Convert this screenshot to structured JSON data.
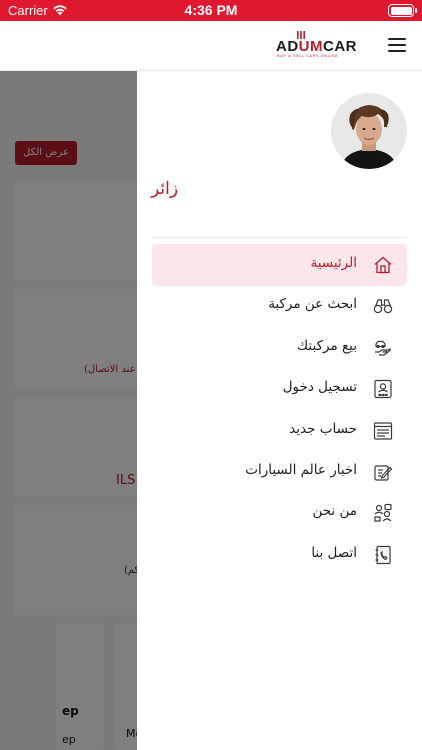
{
  "status_bar": {
    "carrier": "Carrier",
    "time": "4:36 PM"
  },
  "header": {
    "logo_text_a": "AD",
    "logo_text_b": "UM",
    "logo_text_c": "CAR",
    "logo_tagline": "BUY & SELL CARS ONLINE",
    "menu_icon": "hamburger-icon"
  },
  "background_page": {
    "show_all_button": "عرض الكل",
    "snippet_contact": "عند الاتصال)",
    "snippet_currency": "ILS",
    "snippet_km": "كم)",
    "snippet_brand_a": "ep",
    "snippet_brand_b": "ep",
    "snippet_model": "Mc"
  },
  "drawer": {
    "user_name": "زائر",
    "menu_items": [
      {
        "label": "الرئيسية",
        "icon": "home-icon",
        "active": true
      },
      {
        "label": "ابحث عن مركبة",
        "icon": "binoculars-icon",
        "active": false
      },
      {
        "label": "بيع مركبتك",
        "icon": "hand-car-icon",
        "active": false
      },
      {
        "label": "تسجيل دخول",
        "icon": "login-card-icon",
        "active": false
      },
      {
        "label": "حساب جديد",
        "icon": "new-account-icon",
        "active": false
      },
      {
        "label": "اخبار عالم السيارات",
        "icon": "news-edit-icon",
        "active": false
      },
      {
        "label": "من نحن",
        "icon": "about-us-icon",
        "active": false
      },
      {
        "label": "اتصل بنا",
        "icon": "contact-book-icon",
        "active": false
      }
    ]
  },
  "colors": {
    "brand_red": "#b71c2c",
    "status_red": "#e0182f",
    "active_bg": "#fbe7ea",
    "icon_dark": "#3a3a3a"
  }
}
